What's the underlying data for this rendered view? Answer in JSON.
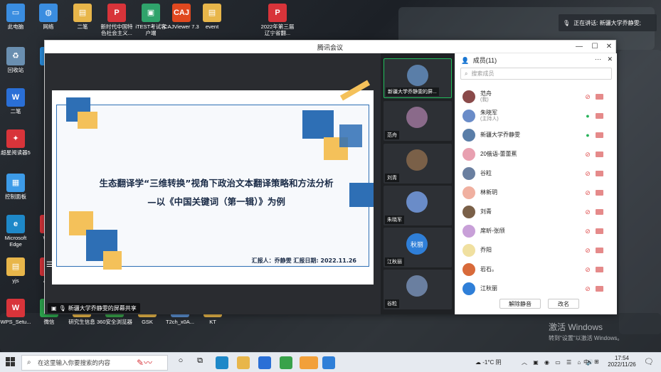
{
  "desktop": {
    "icons_left": [
      {
        "label": "此电脑",
        "color": "#3a8de0",
        "glyph": "▭"
      },
      {
        "label": "回收站",
        "color": "#6a8fb0",
        "glyph": "♻"
      },
      {
        "label": "二笔",
        "color": "#2a6fd6",
        "glyph": "W"
      },
      {
        "label": "超星阅读器5",
        "color": "#d8343a",
        "glyph": "✦"
      },
      {
        "label": "控制面板",
        "color": "#3d9be8",
        "glyph": "▦"
      },
      {
        "label": "Microsoft Edge",
        "color": "#1e88c8",
        "glyph": "e"
      },
      {
        "label": "yjs",
        "color": "#e8b64a",
        "glyph": "▤"
      },
      {
        "label": "WPS_Setu...",
        "color": "#d8343a",
        "glyph": "W"
      }
    ],
    "icons_top": [
      {
        "label": "网络",
        "color": "#3a8de0",
        "glyph": "◍"
      },
      {
        "label": "二笔",
        "color": "#e8b64a",
        "glyph": "▤"
      },
      {
        "label": "新时代中国特色社会主义...",
        "color": "#d8343a",
        "glyph": "P"
      },
      {
        "label": "iTEST考试客户端",
        "color": "#2fa36b",
        "glyph": "▣"
      },
      {
        "label": "CAJViewer 7.3",
        "color": "#e0481f",
        "glyph": "CAJ"
      },
      {
        "label": "event",
        "color": "#e8b64a",
        "glyph": "▤"
      },
      {
        "label": "2022年第三届辽宁省翻...",
        "color": "#d8343a",
        "glyph": "P"
      }
    ],
    "icons_partial": [
      {
        "label": "Ten",
        "color": "#2a8fe0",
        "glyph": "◉"
      },
      {
        "label": "WPS",
        "color": "#d8343a",
        "glyph": "W"
      },
      {
        "label": "A Ce",
        "color": "#d8343a",
        "glyph": "◎"
      }
    ],
    "icons_bottom": [
      {
        "label": "微信",
        "color": "#2ea84f",
        "glyph": "✉"
      },
      {
        "label": "研究生信息",
        "color": "#e8b64a",
        "glyph": "▤"
      },
      {
        "label": "360安全浏览器",
        "color": "#38a24a",
        "glyph": "e"
      },
      {
        "label": "GSK",
        "color": "#e8b64a",
        "glyph": "▤"
      },
      {
        "label": "T2ch_x0A...",
        "color": "#5a8fd0",
        "glyph": "▭"
      },
      {
        "label": "KT",
        "color": "#e8b64a",
        "glyph": "▤"
      }
    ],
    "speaking": "正在讲话: 新疆大学乔静雯;",
    "watermark_title": "激活 Windows",
    "watermark_sub": "转到\"设置\"以激活 Windows。"
  },
  "window": {
    "title": "腾讯会议",
    "share": {
      "title_line1": "生态翻译学“三维转换”视角下政治文本翻译策略和方法分析",
      "title_line2": "—以《中国关键词（第一辑）》为例",
      "reporter": "汇报人：乔静雯  汇报日期: 2022.11.26",
      "label": "新疆大学乔静雯的屏幕共享"
    },
    "videos": [
      {
        "name": "新疆大学乔静雯的屏...",
        "color": "#5a7ea8"
      },
      {
        "name": "范舟",
        "color": "#8a6a8a"
      },
      {
        "name": "刘青",
        "color": "#7a6048"
      },
      {
        "name": "朱晓军",
        "color": "#6a8cc8"
      },
      {
        "name": "江秋丽",
        "color": "#2f7fd8",
        "initials": "秋丽"
      },
      {
        "name": "谷粒",
        "color": "#6a7fa0"
      }
    ],
    "members_panel": {
      "title": "成员(11)",
      "search_placeholder": "搜索成员",
      "list": [
        {
          "name": "范舟",
          "sub": "(我)",
          "color": "#8a4a4a"
        },
        {
          "name": "朱晓军",
          "sub": "(主持人)",
          "color": "#6a8cc8"
        },
        {
          "name": "新疆大学乔静雯",
          "sub": "",
          "color": "#5a7ea8"
        },
        {
          "name": "20俄语-蕾蕾蕉",
          "sub": "",
          "color": "#e8a0b0"
        },
        {
          "name": "谷粒",
          "sub": "",
          "color": "#6a7fa0"
        },
        {
          "name": "林新玥",
          "sub": "",
          "color": "#f0b0a0"
        },
        {
          "name": "刘青",
          "sub": "",
          "color": "#7a6048"
        },
        {
          "name": "席昕-张颀",
          "sub": "",
          "color": "#c8a0d8"
        },
        {
          "name": "乔阳",
          "sub": "",
          "color": "#f0e0a0"
        },
        {
          "name": "岩石。",
          "sub": "",
          "color": "#d86a3a"
        },
        {
          "name": "江秋丽",
          "sub": "",
          "color": "#2f7fd8"
        }
      ],
      "unmute_all": "解除静音",
      "rename": "改名"
    }
  },
  "taskbar": {
    "search_placeholder": "在这里输入你要搜索的内容",
    "weather": "-1°C 阴",
    "ime": "中",
    "time": "17:54",
    "date": "2022/11/26"
  }
}
